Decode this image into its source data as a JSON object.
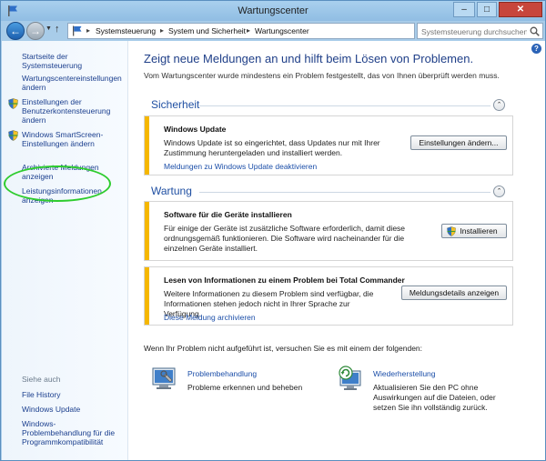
{
  "window": {
    "title": "Wartungscenter",
    "minimize": "–",
    "maximize": "□",
    "close": "✕"
  },
  "address": {
    "crumbs": [
      "Systemsteuerung",
      "System und Sicherheit",
      "Wartungscenter"
    ],
    "search_placeholder": "Systemsteuerung durchsuchen"
  },
  "sidebar": {
    "home": "Startseite der Systemsteuerung",
    "items": [
      {
        "label": "Wartungscentereinstellungen ändern"
      },
      {
        "label": "Einstellungen der Benutzerkontensteuerung ändern"
      },
      {
        "label": "Windows SmartScreen-Einstellungen ändern"
      },
      {
        "label": "Archivierte Meldungen anzeigen"
      },
      {
        "label": "Leistungsinformationen anzeigen"
      }
    ],
    "see_also": "Siehe auch",
    "see_also_items": [
      {
        "label": "File History"
      },
      {
        "label": "Windows Update"
      },
      {
        "label": "Windows-Problembehandlung für die Programmkompatibilität"
      }
    ]
  },
  "main": {
    "title": "Zeigt neue Meldungen an und hilft beim Lösen von Problemen.",
    "subtitle": "Vom Wartungscenter wurde mindestens ein Problem festgestellt, das von Ihnen überprüft werden muss.",
    "security": {
      "heading": "Sicherheit",
      "card": {
        "title": "Windows Update",
        "text": "Windows Update ist so eingerichtet, dass Updates nur mit Ihrer Zustimmung heruntergeladen und installiert werden.",
        "link": "Meldungen zu Windows Update deaktivieren",
        "button": "Einstellungen ändern..."
      }
    },
    "maintenance": {
      "heading": "Wartung",
      "cards": [
        {
          "title": "Software für die Geräte installieren",
          "text": "Für einige der Geräte ist zusätzliche Software erforderlich, damit diese ordnungsgemäß funktionieren. Die Software wird nacheinander für die einzelnen Geräte installiert.",
          "button": "Installieren"
        },
        {
          "title": "Lesen von Informationen zu einem Problem bei Total Commander",
          "text": "Weitere Informationen zu diesem Problem sind verfügbar, die Informationen stehen jedoch nicht in Ihrer Sprache zur Verfügung.",
          "link": "Diese Meldung archivieren",
          "button": "Meldungsdetails anzeigen"
        }
      ]
    },
    "footer_text": "Wenn Ihr Problem nicht aufgeführt ist, versuchen Sie es mit einem der folgenden:",
    "tools": [
      {
        "title": "Problembehandlung",
        "desc": "Probleme erkennen und beheben"
      },
      {
        "title": "Wiederherstellung",
        "desc": "Aktualisieren Sie den PC ohne Auswirkungen auf die Dateien, oder setzen Sie ihn vollständig zurück."
      }
    ]
  }
}
